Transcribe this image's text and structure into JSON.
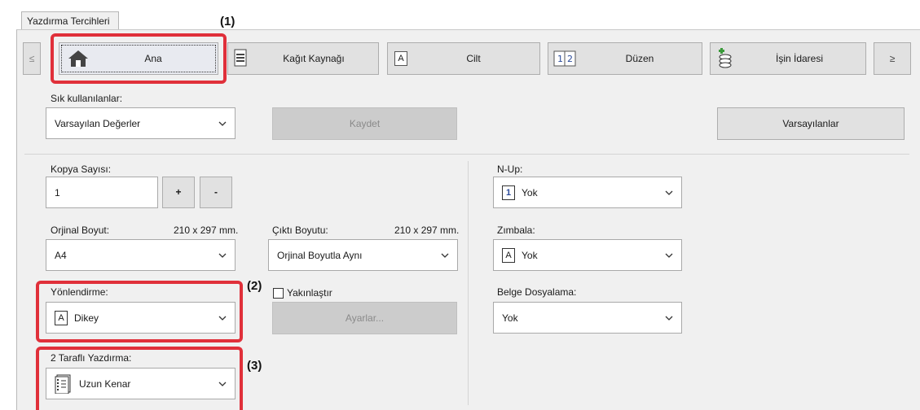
{
  "window": {
    "tab_title": "Yazdırma Tercihleri"
  },
  "nav": {
    "prev": "≤",
    "next": "≥",
    "items": [
      {
        "label": "Ana",
        "icon": "home-icon"
      },
      {
        "label": "Kağıt Kaynağı",
        "icon": "paper-tray-icon"
      },
      {
        "label": "Cilt",
        "icon": "letter-a-icon"
      },
      {
        "label": "Düzen",
        "icon": "layout-icon"
      },
      {
        "label": "İşin İdaresi",
        "icon": "coins-icon"
      }
    ]
  },
  "favorites": {
    "label": "Sık kullanılanlar:",
    "value": "Varsayılan Değerler",
    "save": "Kaydet",
    "defaults": "Varsayılanlar"
  },
  "copies": {
    "label": "Kopya Sayısı:",
    "value": "1",
    "plus": "+",
    "minus": "-"
  },
  "original_size": {
    "label": "Orjinal Boyut:",
    "size": "210 x 297 mm.",
    "value": "A4"
  },
  "output_size": {
    "label": "Çıktı Boyutu:",
    "size": "210 x 297 mm.",
    "value": "Orjinal Boyutla Aynı"
  },
  "orientation": {
    "label": "Yönlendirme:",
    "value": "Dikey",
    "icon_glyph": "A"
  },
  "zoom": {
    "label": "Yakınlaştır",
    "checked": false,
    "settings": "Ayarlar..."
  },
  "duplex": {
    "label": "2 Taraflı Yazdırma:",
    "value": "Uzun Kenar"
  },
  "nup": {
    "label": "N-Up:",
    "value": "Yok",
    "icon_glyph": "1"
  },
  "staple": {
    "label": "Zımbala:",
    "value": "Yok",
    "icon_glyph": "A"
  },
  "filing": {
    "label": "Belge Dosyalama:",
    "value": "Yok"
  },
  "callouts": {
    "c1": "(1)",
    "c2": "(2)",
    "c3": "(3)"
  },
  "colors": {
    "highlight": "#e0303a",
    "panel": "#f0f0f0",
    "button": "#e1e1e1"
  }
}
